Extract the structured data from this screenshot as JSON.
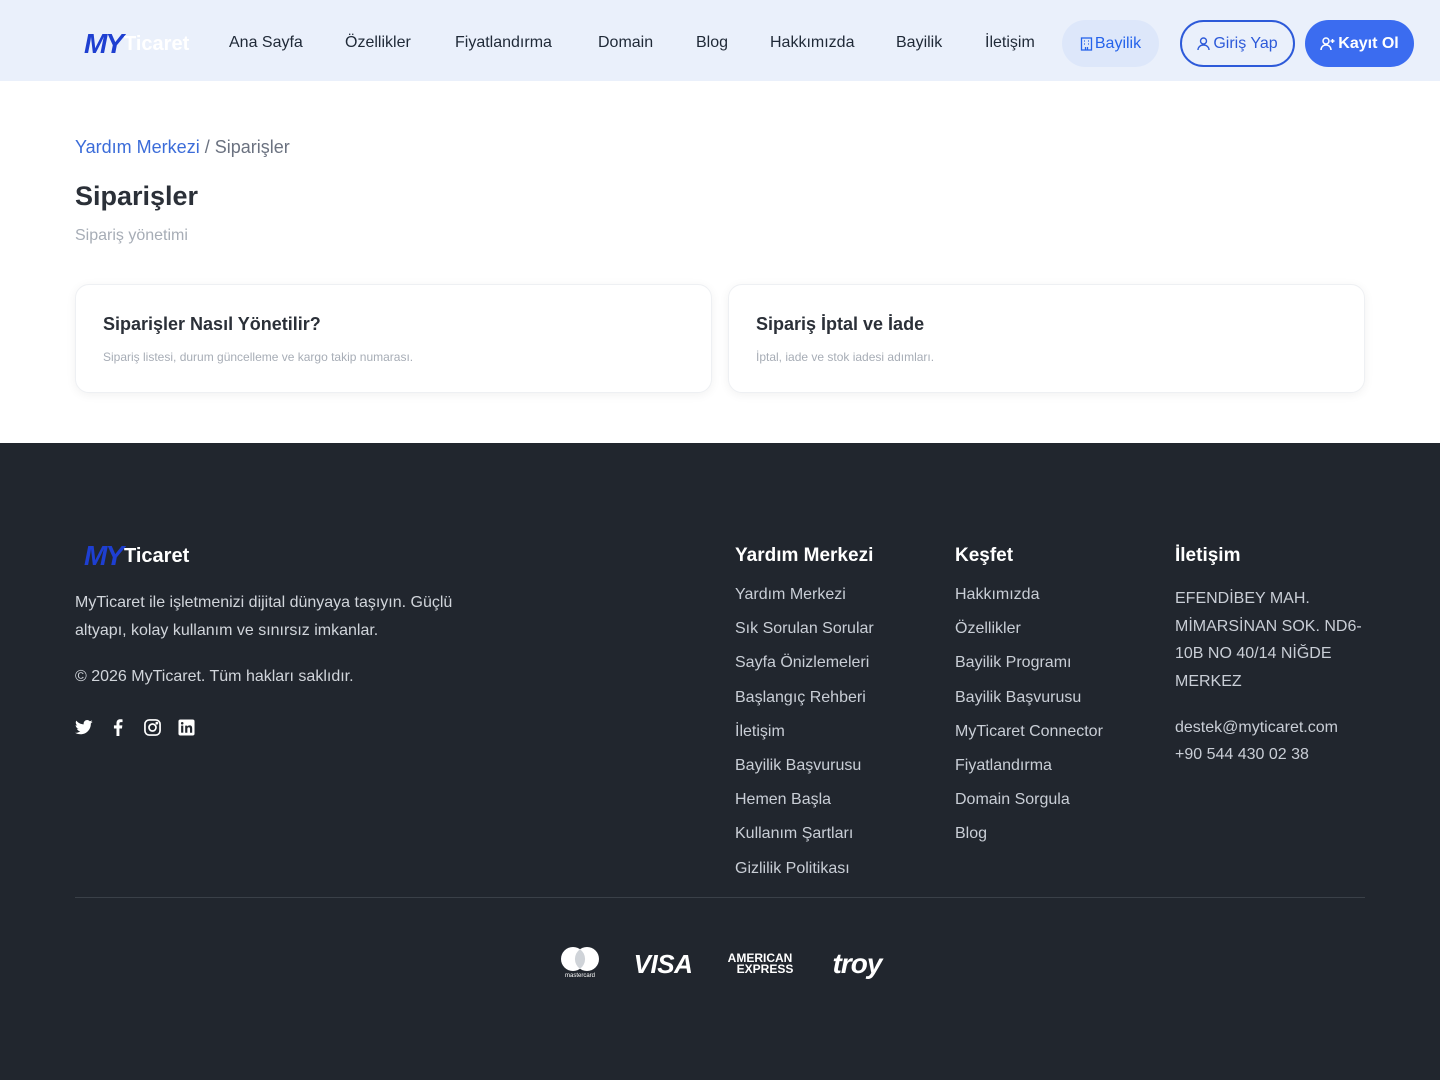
{
  "nav": {
    "logo_my": "MY",
    "logo_text": "Ticaret",
    "links": [
      "Ana Sayfa",
      "Özellikler",
      "Fiyatlandırma",
      "Domain",
      "Blog",
      "Hakkımızda",
      "Bayilik",
      "İletişim"
    ],
    "bayilik_pill": "Bayilik",
    "login": "Giriş Yap",
    "register": "Kayıt Ol"
  },
  "breadcrumb": {
    "root": "Yardım Merkezi",
    "separator": "/",
    "current": "Siparişler"
  },
  "page": {
    "title": "Siparişler",
    "subtitle": "Sipariş yönetimi"
  },
  "cards": [
    {
      "title": "Siparişler Nasıl Yönetilir?",
      "desc": "Sipariş listesi, durum güncelleme ve kargo takip numarası."
    },
    {
      "title": "Sipariş İptal ve İade",
      "desc": "İptal, iade ve stok iadesi adımları."
    }
  ],
  "footer": {
    "logo_my": "MY",
    "logo_text": "Ticaret",
    "about": "MyTicaret ile işletmenizi dijital dünyaya taşıyın. Güçlü altyapı, kolay kullanım ve sınırsız imkanlar.",
    "copyright": "© 2026 MyTicaret. Tüm hakları saklıdır.",
    "social": [
      "twitter-icon",
      "facebook-icon",
      "instagram-icon",
      "linkedin-icon"
    ],
    "help": {
      "heading": "Yardım Merkezi",
      "items": [
        "Yardım Merkezi",
        "Sık Sorulan Sorular",
        "Sayfa Önizlemeleri",
        "Başlangıç Rehberi",
        "İletişim",
        "Bayilik Başvurusu",
        "Hemen Başla",
        "Kullanım Şartları",
        "Gizlilik Politikası"
      ]
    },
    "explore": {
      "heading": "Keşfet",
      "items": [
        "Hakkımızda",
        "Özellikler",
        "Bayilik Programı",
        "Bayilik Başvurusu",
        "MyTicaret Connector",
        "Fiyatlandırma",
        "Domain Sorgula",
        "Blog"
      ]
    },
    "contact": {
      "heading": "İletişim",
      "address": "EFENDİBEY MAH. MİMARSİNAN SOK. ND6-10B NO 40/14 NİĞDE MERKEZ",
      "email": "destek@myticaret.com",
      "phone": "+90 544 430 02 38"
    },
    "payments": {
      "mastercard": "mastercard",
      "visa": "VISA",
      "amex_1": "AMERICAN",
      "amex_2": "EXPRESS",
      "troy": "troy"
    }
  },
  "colors": {
    "nav_bg": "#eaf0fb",
    "brand_blue": "#3b6cf0",
    "footer_bg": "#21262e"
  }
}
